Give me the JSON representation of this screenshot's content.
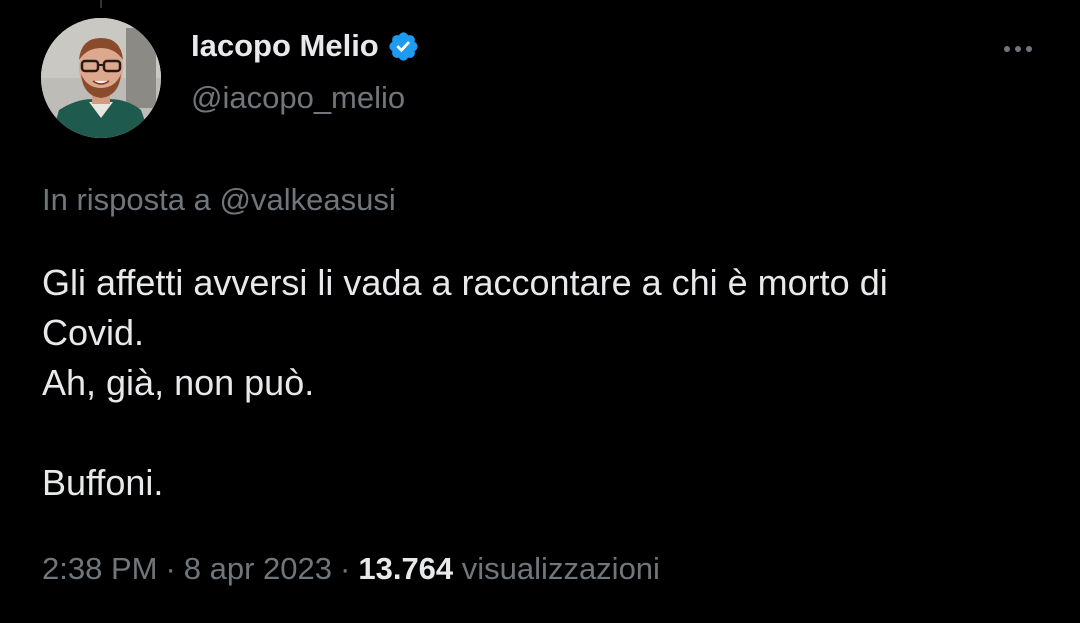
{
  "author": {
    "display_name": "Iacopo Melio",
    "handle": "@iacopo_melio",
    "verified_icon": "verified-badge-icon",
    "verified_color": "#1d9bf0"
  },
  "reply": {
    "prefix": "In risposta a",
    "mention": "@valkeasusi"
  },
  "tweet": {
    "lines": [
      "Gli affetti avversi li vada a raccontare a chi è morto di",
      "Covid.",
      "Ah, già, non può.",
      "Buffoni."
    ]
  },
  "meta": {
    "time": "2:38 PM",
    "separator": "·",
    "date": "8 apr 2023",
    "views_count": "13.764",
    "views_label": "visualizzazioni"
  },
  "colors": {
    "background": "#000000",
    "text_primary": "#e7e9ea",
    "text_secondary": "#71767b"
  },
  "icons": {
    "more": "more-horizontal-icon",
    "avatar": "avatar"
  }
}
